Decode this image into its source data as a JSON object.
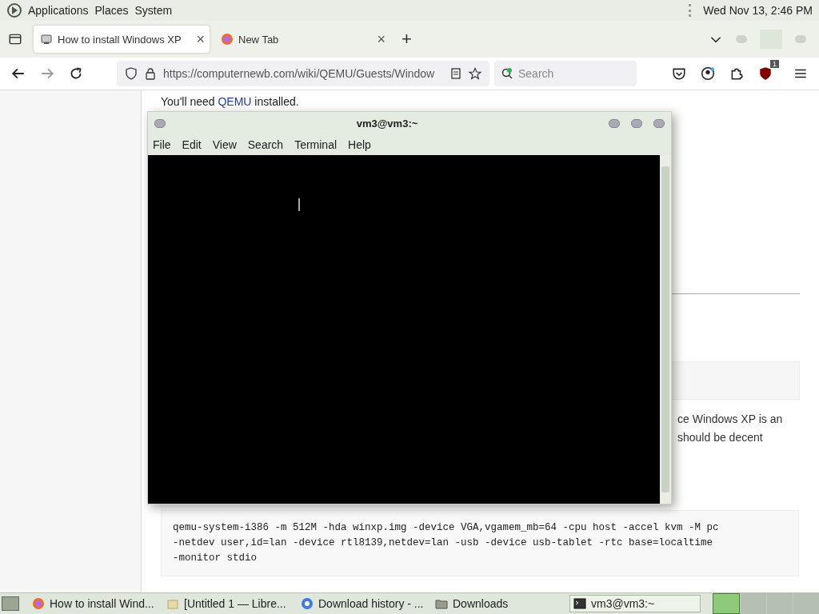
{
  "top_panel": {
    "menus": [
      "Applications",
      "Places",
      "System"
    ],
    "clock": "Wed Nov 13,  2:46 PM"
  },
  "tabs": [
    {
      "title": "How to install Windows XP",
      "close": "×",
      "selected": true
    },
    {
      "title": "New Tab",
      "close": "×",
      "selected": false
    }
  ],
  "new_tab": "+",
  "address_bar": {
    "url": "https://computernewb.com/wiki/QEMU/Guests/Window"
  },
  "search": {
    "placeholder": "Search"
  },
  "extension_badge": "1",
  "page": {
    "intro_before": "You'll need ",
    "intro_link": "QEMU",
    "intro_after": " installed.",
    "partial_lines": [
      "ce Windows XP is an",
      "should be decent"
    ],
    "command_lines": [
      "qemu-system-i386 -m 512M -hda winxp.img -device VGA,vgamem_mb=64 -cpu host -accel kvm -M pc",
      "-netdev user,id=lan -device rtl8139,netdev=lan -usb -device usb-tablet -rtc base=localtime",
      "-monitor stdio"
    ]
  },
  "terminal": {
    "title": "vm3@vm3:~",
    "menus": [
      "File",
      "Edit",
      "View",
      "Search",
      "Terminal",
      "Help"
    ]
  },
  "taskbar": {
    "items": [
      {
        "label": "How to install Wind...",
        "kind": "browser",
        "selected": false
      },
      {
        "label": "[Untitled 1 — Libre...",
        "kind": "document",
        "selected": false
      },
      {
        "label": "Download history - ...",
        "kind": "chrome",
        "selected": false
      },
      {
        "label": "Downloads",
        "kind": "folder",
        "selected": false
      },
      {
        "label": "vm3@vm3:~",
        "kind": "terminal",
        "selected": true
      }
    ]
  }
}
